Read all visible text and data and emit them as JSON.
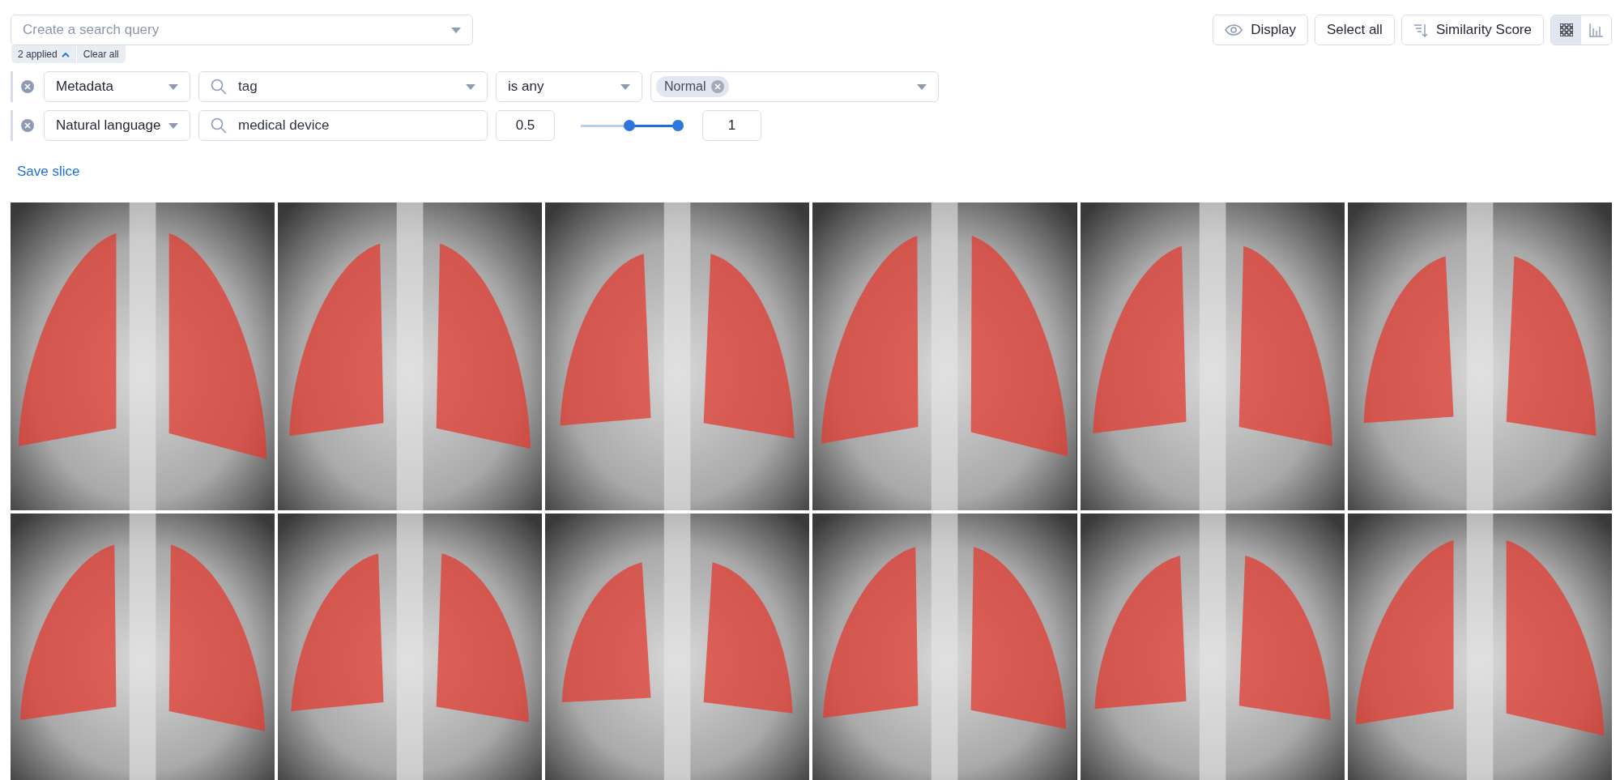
{
  "search": {
    "placeholder": "Create a search query"
  },
  "applied": {
    "label": "2 applied",
    "expanded": true
  },
  "clear_all": "Clear all",
  "filters": [
    {
      "kind": "metadata",
      "type": "Metadata",
      "field": "tag",
      "operator": "is any",
      "values": [
        "Normal"
      ]
    },
    {
      "kind": "similarity",
      "type": "Natural language",
      "query": "medical device",
      "min": "0.5",
      "max": "1",
      "thumbs": [
        {
          "level": 0.5
        },
        {
          "level": 1
        }
      ]
    }
  ],
  "save_slice": "Save slice",
  "toolbar": {
    "display": "Display",
    "select_all": "Select all",
    "sort": "Similarity Score",
    "views": [
      {
        "kind": "grid",
        "selected": true
      },
      {
        "kind": "chart",
        "selected": false
      }
    ]
  },
  "gallery": [
    {
      "kind": "xray"
    },
    {
      "kind": "xray"
    },
    {
      "kind": "xray"
    },
    {
      "kind": "xray"
    },
    {
      "kind": "xray"
    },
    {
      "kind": "xray"
    },
    {
      "kind": "xray"
    },
    {
      "kind": "xray"
    },
    {
      "kind": "xray"
    },
    {
      "kind": "xray"
    },
    {
      "kind": "xray"
    },
    {
      "kind": "xray"
    }
  ]
}
